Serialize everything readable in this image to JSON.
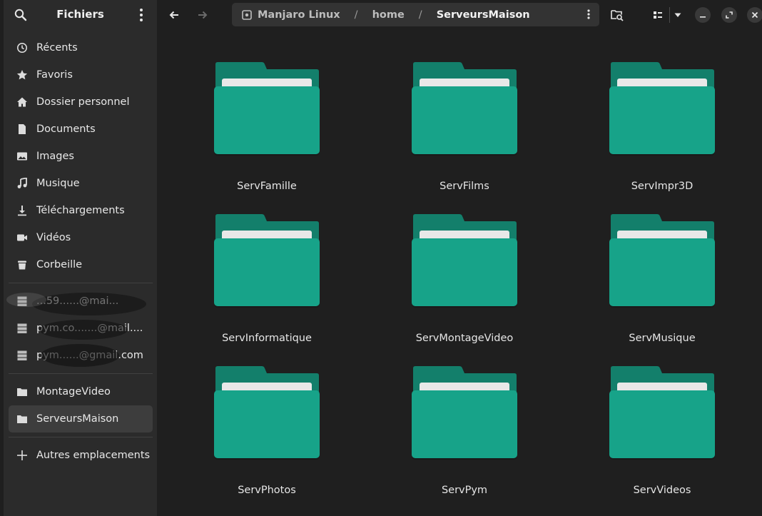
{
  "sidebar": {
    "title": "Fichiers",
    "places": [
      {
        "label": "Récents",
        "icon": "clock-icon"
      },
      {
        "label": "Favoris",
        "icon": "star-icon"
      },
      {
        "label": "Dossier personnel",
        "icon": "home-icon"
      },
      {
        "label": "Documents",
        "icon": "document-icon"
      },
      {
        "label": "Images",
        "icon": "image-icon"
      },
      {
        "label": "Musique",
        "icon": "music-icon"
      },
      {
        "label": "Téléchargements",
        "icon": "download-icon"
      },
      {
        "label": "Vidéos",
        "icon": "video-icon"
      },
      {
        "label": "Corbeille",
        "icon": "trash-icon"
      }
    ],
    "network": [
      {
        "label": "...59......@mai...",
        "icon": "server-icon"
      },
      {
        "label": "pym.co.......@mail....",
        "icon": "server-icon"
      },
      {
        "label": "pym......@gmail.com",
        "icon": "server-icon"
      }
    ],
    "bookmarks": [
      {
        "label": "MontageVideo",
        "icon": "folder-icon",
        "selected": false
      },
      {
        "label": "ServeursMaison",
        "icon": "folder-icon",
        "selected": true
      }
    ],
    "other_locations": "Autres emplacements"
  },
  "path": {
    "segments": [
      "Manjaro Linux",
      "home",
      "ServeursMaison"
    ],
    "separator": "/"
  },
  "folders": [
    "ServFamille",
    "ServFilms",
    "ServImpr3D",
    "ServInformatique",
    "ServMontageVideo",
    "ServMusique",
    "ServPhotos",
    "ServPym",
    "ServVideos"
  ],
  "colors": {
    "folder_body": "#17a389",
    "folder_tab": "#137f6b",
    "folder_paper": "#e8e8e8",
    "sidebar_bg": "#2b2b2b",
    "main_bg": "#1f1f1f"
  }
}
